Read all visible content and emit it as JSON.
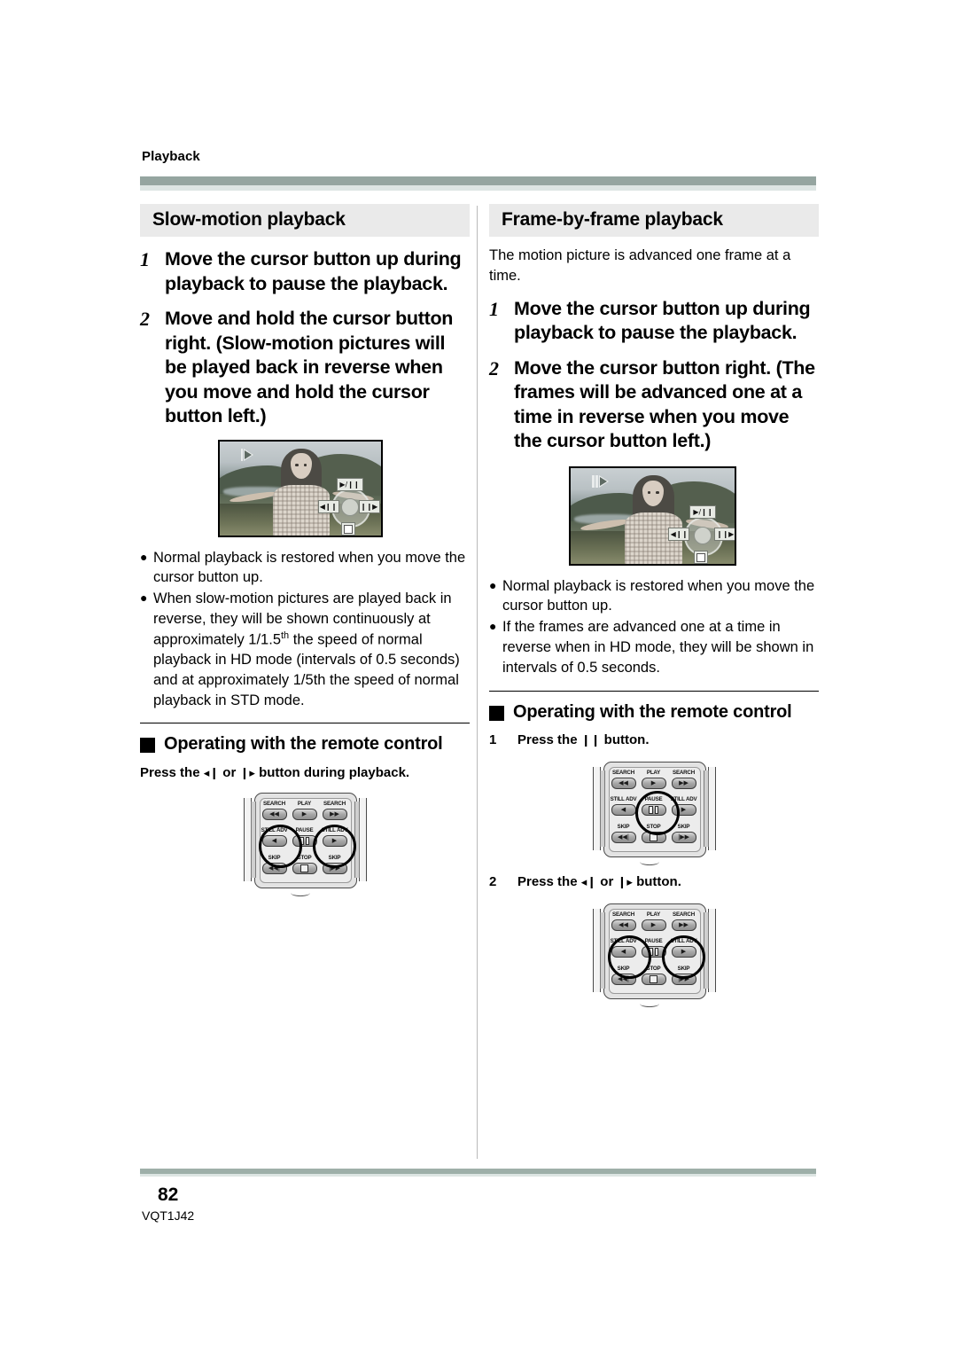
{
  "header": {
    "running_head": "Playback"
  },
  "footer": {
    "page_number": "82",
    "document_id": "VQT1J42"
  },
  "left_column": {
    "section_title": "Slow-motion playback",
    "steps": [
      {
        "num": "1",
        "text": "Move the cursor button up during playback to pause the playback."
      },
      {
        "num": "2",
        "text": "Move and hold the cursor button right. (Slow-motion pictures will be played back in reverse when you move and hold the cursor button left.)"
      }
    ],
    "lcd": {
      "status_icon": "slow-motion-forward-icon",
      "joystick": {
        "up_label": "▶/❙❙",
        "left_label": "◀❙❙",
        "right_label": "❙❙▶",
        "down_label": "stop-square-icon"
      }
    },
    "bullets": [
      "Normal playback is restored when you move the cursor button up.",
      "When slow-motion pictures are played back in reverse, they will be shown continuously at approximately 1/1.5th the speed of normal playback in HD mode (intervals of 0.5 seconds) and at approximately 1/5th the speed of normal playback in STD mode."
    ],
    "bullet2_parts": {
      "before_sup": "When slow-motion pictures are played back in reverse, they will be shown continuously at approximately 1/1.5",
      "sup": "th",
      "after_sup": " the speed of normal playback in HD mode (intervals of 0.5 seconds) and at approximately 1/5th the speed of normal playback in STD mode."
    },
    "remote_section": {
      "heading": "Operating with the remote control",
      "instruction_before": "Press the ",
      "instruction_glyph_1": "◂❙",
      "instruction_mid": " or ",
      "instruction_glyph_2": "❙▸",
      "instruction_after": " button during playback."
    }
  },
  "right_column": {
    "section_title": "Frame-by-frame playback",
    "intro": "The motion picture is advanced one frame at a time.",
    "steps": [
      {
        "num": "1",
        "text": "Move the cursor button up during playback to pause the playback."
      },
      {
        "num": "2",
        "text": "Move the cursor button right. (The frames will be advanced one at a time in reverse when you move the cursor button left.)"
      }
    ],
    "lcd": {
      "status_icon": "frame-advance-forward-icon",
      "joystick": {
        "up_label": "▶/❙❙",
        "left_label": "◀❙❙",
        "right_label": "❙❙▶",
        "down_label": "stop-square-icon"
      }
    },
    "bullets": [
      "Normal playback is restored when you move the cursor button up.",
      "If the frames are advanced one at a time in reverse when in HD mode, they will be shown in intervals of 0.5 seconds."
    ],
    "remote_section": {
      "heading": "Operating with the remote control",
      "steps": [
        {
          "num": "1",
          "before": "Press the ",
          "glyph": "❙❙",
          "after": " button."
        },
        {
          "num": "2",
          "before": "Press the ",
          "glyph_1": "◂❙",
          "mid": " or ",
          "glyph_2": "❙▸",
          "after": " button."
        }
      ]
    }
  },
  "remote_keys": {
    "row1": [
      {
        "label": "SEARCH",
        "glyph": "◀◀"
      },
      {
        "label": "PLAY",
        "glyph": "▶"
      },
      {
        "label": "SEARCH",
        "glyph": "▶▶"
      }
    ],
    "row2": [
      {
        "label": "STILL ADV",
        "glyph": "◀"
      },
      {
        "label": "PAUSE",
        "glyph": "pause-bars-icon"
      },
      {
        "label": "STILL ADV",
        "glyph": "▶"
      }
    ],
    "row3": [
      {
        "label": "SKIP",
        "glyph": "◀◀|"
      },
      {
        "label": "STOP",
        "glyph": "stop-square-icon"
      },
      {
        "label": "SKIP",
        "glyph": "|▶▶"
      }
    ]
  },
  "colors": {
    "rule": "#95a5a0",
    "rule_light": "#dde5e3",
    "section_band": "#eaeaea",
    "footer_rule": "#9eafa9"
  }
}
